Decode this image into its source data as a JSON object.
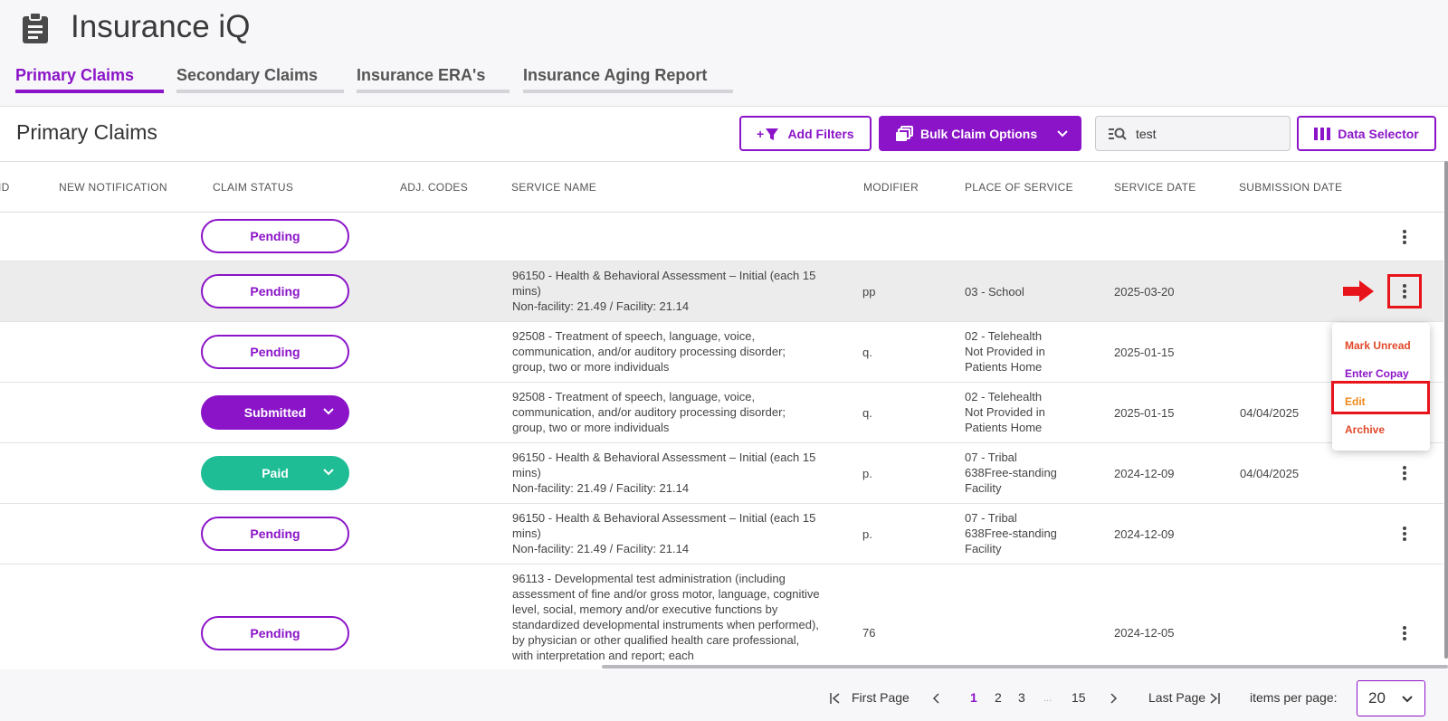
{
  "app": {
    "title": "Insurance iQ",
    "icon": "clipboard-icon"
  },
  "tabs": [
    {
      "label": "Primary Claims",
      "active": true
    },
    {
      "label": "Secondary Claims",
      "active": false
    },
    {
      "label": "Insurance ERA's",
      "active": false
    },
    {
      "label": "Insurance Aging Report",
      "active": false
    }
  ],
  "section": {
    "title": "Primary Claims"
  },
  "toolbar": {
    "add_filters_label": "Add Filters",
    "add_filters_icon": "add-filter-icon",
    "bulk_label": "Bulk Claim Options",
    "bulk_icon": "stacked-copies-icon",
    "search_value": "test",
    "search_icon": "search-list-icon",
    "data_selector_label": "Data Selector",
    "data_selector_icon": "columns-icon"
  },
  "columns": [
    "ID",
    "NEW NOTIFICATION",
    "CLAIM STATUS",
    "ADJ. CODES",
    "SERVICE NAME",
    "MODIFIER",
    "PLACE OF SERVICE",
    "SERVICE DATE",
    "SUBMISSION DATE"
  ],
  "rows": [
    {
      "status": "Pending",
      "service": [
        "",
        "",
        ""
      ],
      "modifier": "",
      "pos": [
        "",
        "",
        ""
      ],
      "service_date": "",
      "submission_date": ""
    },
    {
      "status": "Pending",
      "service": [
        "96150 - Health & Behavioral Assessment – Initial (each 15 mins)",
        "Non-facility: 21.49 / Facility: 21.14",
        ""
      ],
      "modifier": "pp",
      "pos": [
        "03 - School",
        "",
        ""
      ],
      "service_date": "2025-03-20",
      "submission_date": ""
    },
    {
      "status": "Pending",
      "service": [
        "92508 - Treatment of speech, language, voice, communication, and/or auditory processing disorder; group, two or more individuals",
        "",
        ""
      ],
      "modifier": "q.",
      "pos": [
        "02 - Telehealth",
        "Not Provided in",
        "Patients Home"
      ],
      "service_date": "2025-01-15",
      "submission_date": ""
    },
    {
      "status": "Submitted",
      "service": [
        "92508 - Treatment of speech, language, voice, communication, and/or auditory processing disorder; group, two or more individuals",
        "",
        ""
      ],
      "modifier": "q.",
      "pos": [
        "02 - Telehealth",
        "Not Provided in",
        "Patients Home"
      ],
      "service_date": "2025-01-15",
      "submission_date": "04/04/2025"
    },
    {
      "status": "Paid",
      "service": [
        "96150 - Health & Behavioral Assessment – Initial (each 15 mins)",
        "Non-facility: 21.49 / Facility: 21.14",
        ""
      ],
      "modifier": "p.",
      "pos": [
        "07 - Tribal",
        "638Free-standing",
        "Facility"
      ],
      "service_date": "2024-12-09",
      "submission_date": "04/04/2025"
    },
    {
      "status": "Pending",
      "service": [
        "96150 - Health & Behavioral Assessment – Initial (each 15 mins)",
        "Non-facility: 21.49 / Facility: 21.14",
        ""
      ],
      "modifier": "p.",
      "pos": [
        "07 - Tribal",
        "638Free-standing",
        "Facility"
      ],
      "service_date": "2024-12-09",
      "submission_date": ""
    },
    {
      "status": "Pending",
      "service": [
        "96113 - Developmental test administration (including assessment of fine and/or gross motor, language, cognitive level, social, memory and/or executive functions by standardized developmental instruments when performed), by physician or other qualified health care professional, with interpretation and report; each",
        "",
        ""
      ],
      "modifier": "76",
      "pos": [
        "",
        "",
        ""
      ],
      "service_date": "2024-12-05",
      "submission_date": ""
    }
  ],
  "context_menu": {
    "items": [
      "Mark Unread",
      "Enter Copay",
      "Edit",
      "Archive"
    ],
    "colors": [
      "#e0492a",
      "#8b14c8",
      "#f08a1c",
      "#e0492a"
    ]
  },
  "annotations": {
    "arrow_icon": "red-arrow-right-icon",
    "highlight_color": "#e8141b"
  },
  "pagination": {
    "first": "First Page",
    "last": "Last Page",
    "pages": [
      "1",
      "2",
      "3",
      "...",
      "15"
    ],
    "current": "1",
    "items_per_page_label": "items per page:",
    "items_per_page_value": "20"
  },
  "colors": {
    "accent": "#8b14c8",
    "paid": "#1ebd96"
  }
}
